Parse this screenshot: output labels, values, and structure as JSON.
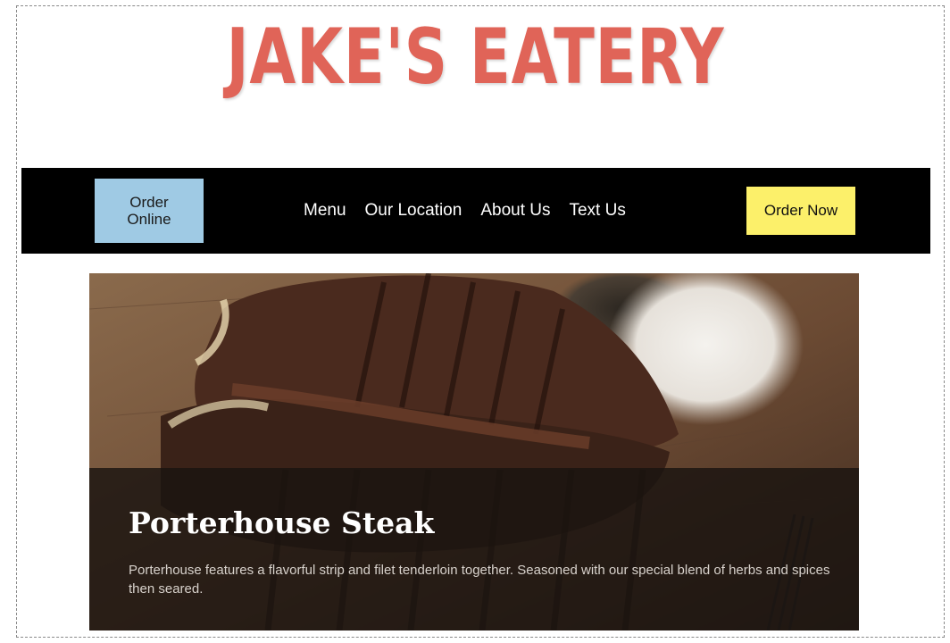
{
  "brand": {
    "name": "JAKE'S EATERY",
    "color": "#e06458"
  },
  "nav": {
    "order_online_label": "Order\nOnline",
    "links": [
      "Menu",
      "Our Location",
      "About Us",
      "Text Us"
    ],
    "order_now_label": "Order Now",
    "background": "#000000",
    "order_online_color": "#9fcae4",
    "order_now_color": "#fcf06a"
  },
  "hero": {
    "image": "porterhouse-steak-photo",
    "title": "Porterhouse Steak",
    "description": "Porterhouse features a flavorful strip and filet tenderloin together. Seasoned with our special blend of herbs and spices then seared."
  }
}
